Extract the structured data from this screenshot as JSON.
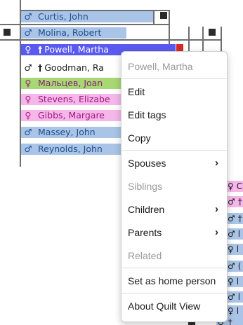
{
  "tree": {
    "symbols": {
      "male": "♂",
      "female": "♀",
      "deceased": "†"
    },
    "people": [
      {
        "name": "Curtis, John",
        "sex": "male",
        "deceased": false
      },
      {
        "name": "Molina, Robert",
        "sex": "male",
        "deceased": false
      },
      {
        "name": "Powell, Martha",
        "sex": "female",
        "deceased": true,
        "selected": true
      },
      {
        "name": "Goodman, Ra",
        "sex": "male",
        "deceased": true
      },
      {
        "name": "Мальцев, Joan",
        "sex": "female",
        "deceased": false
      },
      {
        "name": "Stevens, Elizabe",
        "sex": "female",
        "deceased": false
      },
      {
        "name": "Gibbs, Margare",
        "sex": "female",
        "deceased": false
      },
      {
        "name": "Massey, John",
        "sex": "male",
        "deceased": false
      },
      {
        "name": "Reynolds, John",
        "sex": "male",
        "deceased": false
      }
    ],
    "right_partial": [
      {
        "sym": "♀",
        "text": "C",
        "sex": "female"
      },
      {
        "sym": "♂",
        "text": "†",
        "sex": "female"
      },
      {
        "sym": "♂",
        "text": "† l",
        "sex": "male"
      },
      {
        "sym": "♂",
        "text": "l",
        "sex": "male"
      },
      {
        "sym": "♀",
        "text": "l",
        "sex": "male"
      },
      {
        "sym": "♂",
        "text": "(",
        "sex": "male"
      },
      {
        "sym": "♀",
        "text": "l",
        "sex": "male"
      },
      {
        "sym": "♂",
        "text": "l",
        "sex": "male"
      },
      {
        "sym": "♀",
        "text": "l",
        "sex": "male"
      },
      {
        "sym": "♂",
        "text": "†",
        "sex": "male"
      }
    ]
  },
  "context_menu": {
    "header": "Powell, Martha",
    "items": [
      {
        "label": "Edit",
        "enabled": true,
        "submenu": false
      },
      {
        "label": "Edit tags",
        "enabled": true,
        "submenu": false
      },
      {
        "label": "Copy",
        "enabled": true,
        "submenu": false
      },
      {
        "label": "Spouses",
        "enabled": true,
        "submenu": true
      },
      {
        "label": "Siblings",
        "enabled": false,
        "submenu": false
      },
      {
        "label": "Children",
        "enabled": true,
        "submenu": true
      },
      {
        "label": "Parents",
        "enabled": true,
        "submenu": true
      },
      {
        "label": "Related",
        "enabled": false,
        "submenu": false
      },
      {
        "label": "Set as home person",
        "enabled": true,
        "submenu": false
      },
      {
        "label": "About Quilt View",
        "enabled": true,
        "submenu": false
      }
    ],
    "submenu_arrow": "›"
  }
}
